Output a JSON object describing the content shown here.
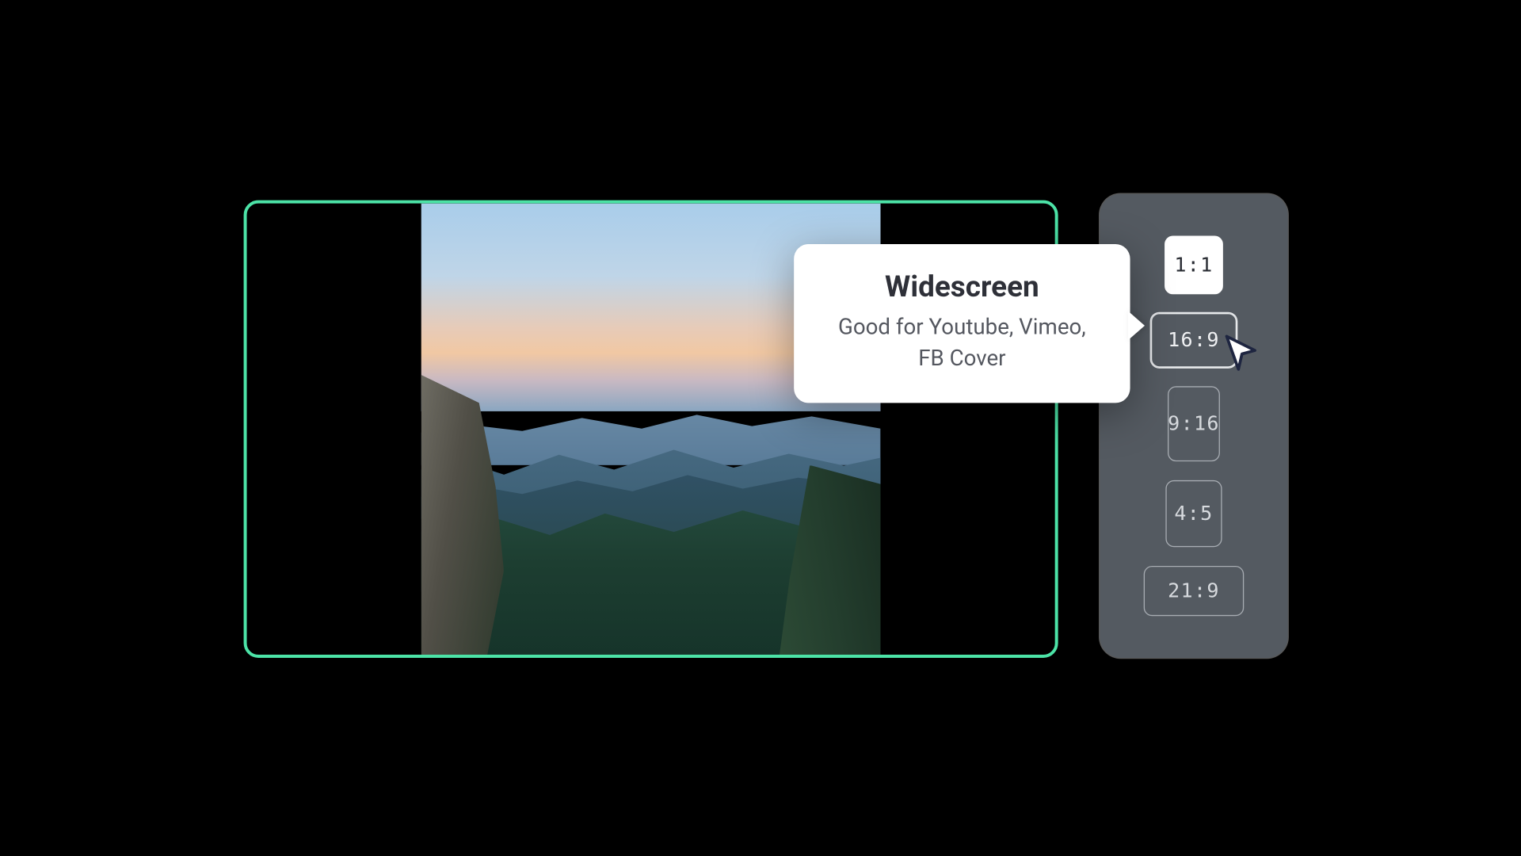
{
  "accent_color": "#4ce3a7",
  "tooltip": {
    "title": "Widescreen",
    "description": "Good for Youtube, Vimeo, FB Cover"
  },
  "ratios": [
    {
      "label": "1:1",
      "sizeClass": "r-1-1",
      "state": "selected"
    },
    {
      "label": "16:9",
      "sizeClass": "r-16-9",
      "state": "hover"
    },
    {
      "label": "9:16",
      "sizeClass": "r-9-16",
      "state": ""
    },
    {
      "label": "4:5",
      "sizeClass": "r-4-5",
      "state": ""
    },
    {
      "label": "21:9",
      "sizeClass": "r-21-9",
      "state": ""
    }
  ]
}
